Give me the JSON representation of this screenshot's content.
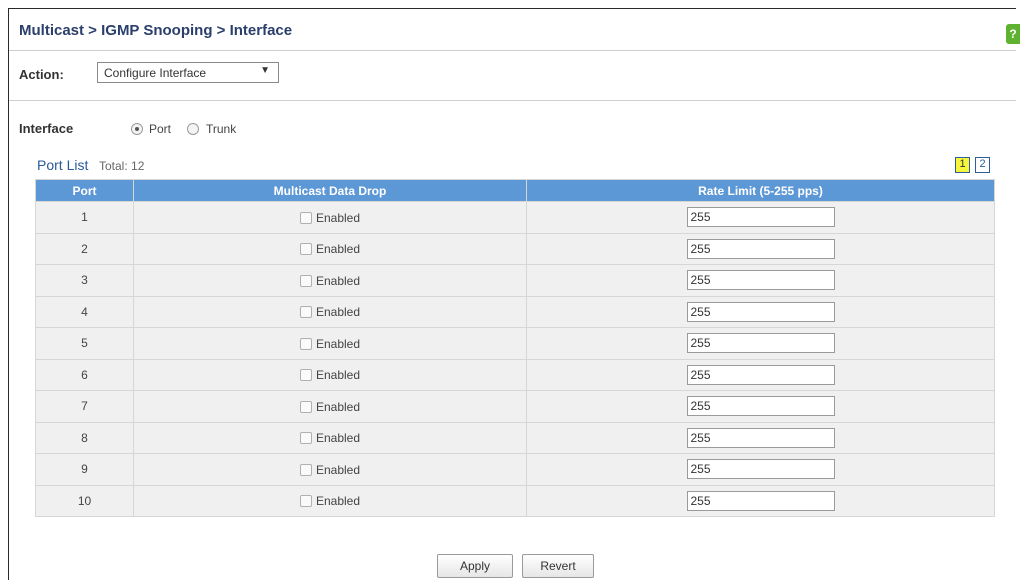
{
  "header": {
    "title": "Multicast > IGMP Snooping > Interface",
    "help_icon": "help-icon"
  },
  "action": {
    "label": "Action:",
    "selected": "Configure Interface"
  },
  "interface": {
    "label": "Interface",
    "options": [
      {
        "label": "Port",
        "selected": true
      },
      {
        "label": "Trunk",
        "selected": false
      }
    ]
  },
  "port_list": {
    "title": "Port List",
    "total": "Total: 12",
    "pages": [
      "1",
      "2"
    ],
    "current_page": "1",
    "columns": [
      "Port",
      "Multicast Data Drop",
      "Rate Limit (5-255 pps)"
    ],
    "rows": [
      {
        "port": "1",
        "drop_label": "Enabled",
        "drop_checked": false,
        "rate": "255"
      },
      {
        "port": "2",
        "drop_label": "Enabled",
        "drop_checked": false,
        "rate": "255"
      },
      {
        "port": "3",
        "drop_label": "Enabled",
        "drop_checked": false,
        "rate": "255"
      },
      {
        "port": "4",
        "drop_label": "Enabled",
        "drop_checked": false,
        "rate": "255"
      },
      {
        "port": "5",
        "drop_label": "Enabled",
        "drop_checked": false,
        "rate": "255"
      },
      {
        "port": "6",
        "drop_label": "Enabled",
        "drop_checked": false,
        "rate": "255"
      },
      {
        "port": "7",
        "drop_label": "Enabled",
        "drop_checked": false,
        "rate": "255"
      },
      {
        "port": "8",
        "drop_label": "Enabled",
        "drop_checked": false,
        "rate": "255"
      },
      {
        "port": "9",
        "drop_label": "Enabled",
        "drop_checked": false,
        "rate": "255"
      },
      {
        "port": "10",
        "drop_label": "Enabled",
        "drop_checked": false,
        "rate": "255"
      }
    ]
  },
  "buttons": {
    "apply": "Apply",
    "revert": "Revert"
  },
  "colors": {
    "header_bg": "#5c97d6",
    "title": "#2a3f6b",
    "active_page": "#f5f53b"
  }
}
